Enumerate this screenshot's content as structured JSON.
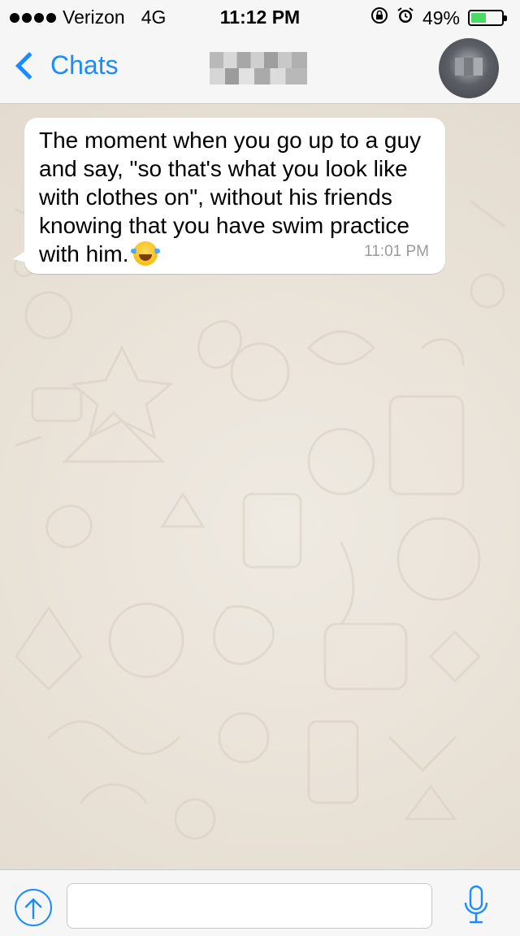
{
  "status_bar": {
    "carrier": "Verizon",
    "network": "4G",
    "time": "11:12 PM",
    "battery_percent": "49%",
    "battery_level": 0.49,
    "icons": [
      "signal-dots-icon",
      "rotation-lock-icon",
      "alarm-icon",
      "battery-icon"
    ]
  },
  "nav": {
    "back_label": "Chats",
    "contact_name": "",
    "icons": [
      "chevron-left-icon",
      "avatar"
    ]
  },
  "messages": [
    {
      "text": "The moment when you go up to a guy and say, \"so that's what you look like with clothes on\", without his friends knowing that you have swim practice with him.",
      "emoji": "face-with-tears-of-joy",
      "time": "11:01 PM",
      "direction": "incoming"
    }
  ],
  "input_bar": {
    "placeholder": "",
    "value": "",
    "icons": [
      "upload-arrow-icon",
      "microphone-icon"
    ]
  },
  "colors": {
    "accent": "#1a8cff",
    "chat_background": "#e9e2d7",
    "bubble": "#ffffff",
    "battery_fill": "#4cd964"
  }
}
